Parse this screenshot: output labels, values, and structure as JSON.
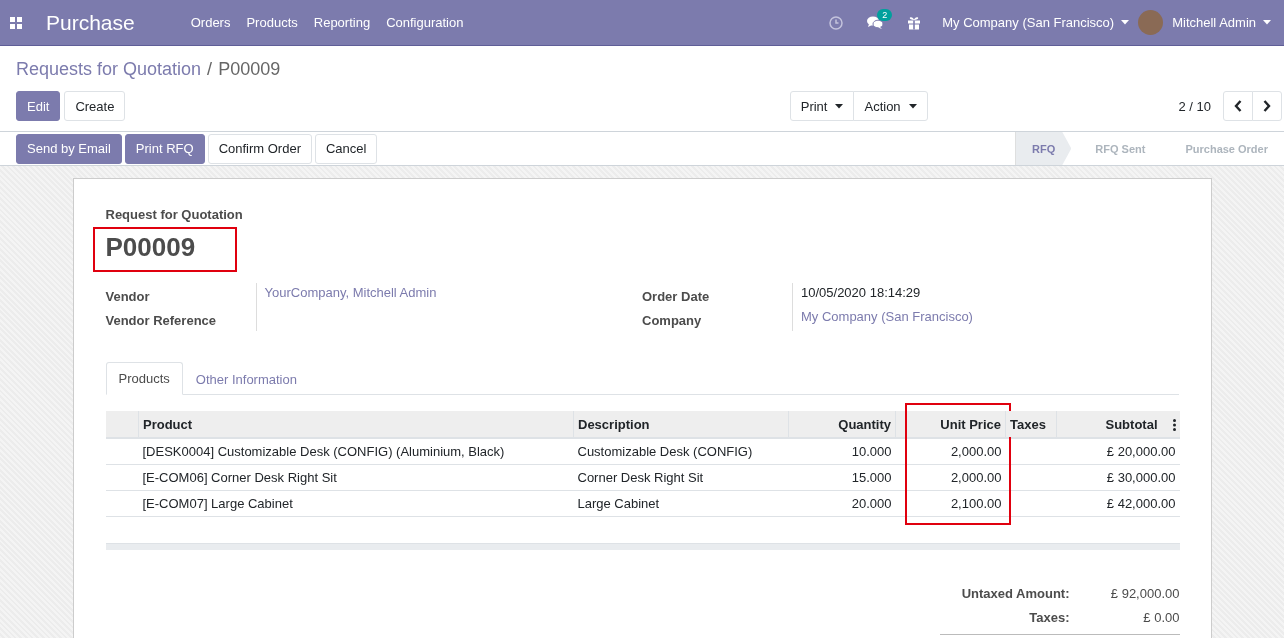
{
  "navbar": {
    "app_title": "Purchase",
    "menu": [
      "Orders",
      "Products",
      "Reporting",
      "Configuration"
    ],
    "messages_badge": "2",
    "company": "My Company (San Francisco)",
    "user": "Mitchell Admin"
  },
  "breadcrumb": {
    "separator": "/",
    "items": [
      {
        "label": "Requests for Quotation",
        "kind": "link"
      },
      {
        "label": "P00009",
        "kind": "current"
      }
    ]
  },
  "actions": [
    {
      "label": "Edit",
      "kind": "edit"
    },
    {
      "label": "Create",
      "kind": "create"
    }
  ],
  "dropdowns": [
    "Print",
    "Action"
  ],
  "pager": "2 / 10",
  "header_buttons": [
    {
      "label": "Send by Email",
      "kind": "primary"
    },
    {
      "label": "Print RFQ",
      "kind": "primary"
    },
    {
      "label": "Confirm Order",
      "kind": "secondary"
    },
    {
      "label": "Cancel",
      "kind": "secondary"
    }
  ],
  "stages": [
    {
      "label": "RFQ",
      "selected": true
    },
    {
      "label": "RFQ Sent",
      "selected": false
    },
    {
      "label": "Purchase Order",
      "selected": false
    }
  ],
  "form": {
    "subtitle": "Request for Quotation",
    "reference": "P00009",
    "reference_highlighted": true,
    "left_fields": [
      {
        "label": "Vendor",
        "value": "YourCompany, Mitchell Admin",
        "kind": "link"
      },
      {
        "label": "Vendor Reference",
        "kind": "empty"
      }
    ],
    "right_fields": [
      {
        "label": "Order Date",
        "value": "10/05/2020 18:14:29",
        "kind": "text"
      },
      {
        "label": "Company",
        "value": "My Company (San Francisco)",
        "kind": "link"
      }
    ],
    "tabs": [
      {
        "label": "Products",
        "selected": true
      },
      {
        "label": "Other Information",
        "selected": false
      }
    ],
    "table": {
      "columns": [
        {
          "label": "Product",
          "kind": "text",
          "highlighted": false
        },
        {
          "label": "Description",
          "kind": "text",
          "highlighted": false
        },
        {
          "label": "Quantity",
          "kind": "number",
          "highlighted": false
        },
        {
          "label": "Unit Price",
          "kind": "number",
          "highlighted": true
        },
        {
          "label": "Taxes",
          "kind": "text",
          "highlighted": false
        },
        {
          "label": "Subtotal",
          "kind": "number",
          "highlighted": false
        }
      ],
      "rows": [
        [
          "[DESK0004] Customizable Desk (CONFIG) (Aluminium, Black)",
          "Customizable Desk (CONFIG)",
          "10.000",
          "2,000.00",
          "",
          "£ 20,000.00"
        ],
        [
          "[E-COM06] Corner Desk Right Sit",
          "Corner Desk Right Sit",
          "15.000",
          "2,000.00",
          "",
          "£ 30,000.00"
        ],
        [
          "[E-COM07] Large Cabinet",
          "Large Cabinet",
          "20.000",
          "2,100.00",
          "",
          "£ 42,000.00"
        ]
      ]
    },
    "totals": [
      {
        "label": "Untaxed Amount:",
        "value": "£ 92,000.00"
      },
      {
        "label": "Taxes:",
        "value": "£ 0.00"
      }
    ]
  }
}
